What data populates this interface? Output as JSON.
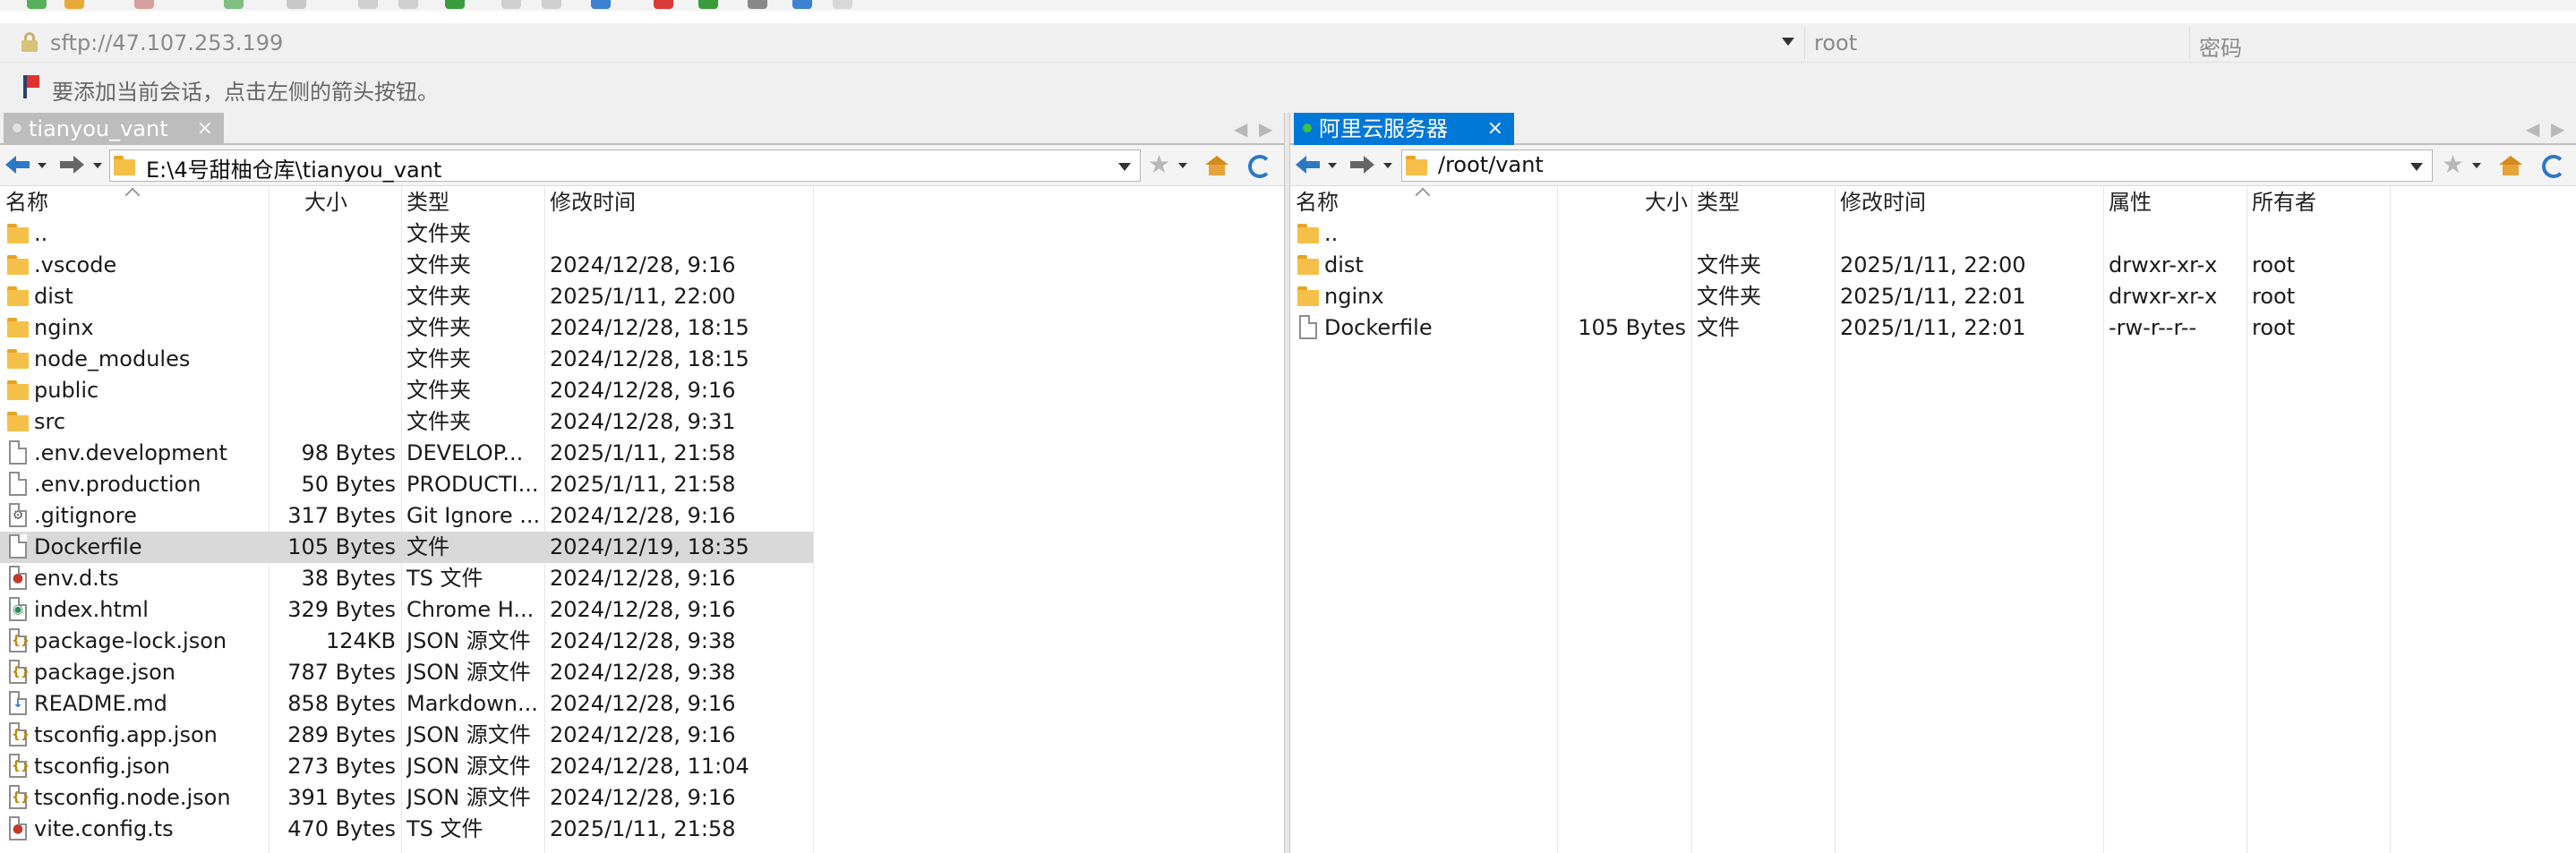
{
  "address": {
    "url": "sftp://47.107.253.199",
    "user_placeholder": "root",
    "password_placeholder": "密码"
  },
  "hint": {
    "text": "要添加当前会话，点击左侧的箭头按钮。"
  },
  "colors": {
    "accent": "#0078d7",
    "folder": "#f5c04a",
    "selected_row": "#d9d9d9",
    "tab_inactive": "#bdbdbd"
  },
  "left_pane": {
    "tab": {
      "label": "tianyou_vant",
      "close": "×",
      "dot_color": "#e0e0e0"
    },
    "path": "E:\\4号甜柚仓库\\tianyou_vant",
    "columns": {
      "name": "名称",
      "size": "大小",
      "type": "类型",
      "modified": "修改时间"
    },
    "files": [
      {
        "name": "..",
        "size": "",
        "type": "文件夹",
        "modified": "",
        "icon": "folder-icon",
        "glyph": "",
        "glyph_color": ""
      },
      {
        "name": ".vscode",
        "size": "",
        "type": "文件夹",
        "modified": "2024/12/28, 9:16",
        "icon": "folder-icon",
        "glyph": "",
        "glyph_color": ""
      },
      {
        "name": "dist",
        "size": "",
        "type": "文件夹",
        "modified": "2025/1/11, 22:00",
        "icon": "folder-icon",
        "glyph": "",
        "glyph_color": ""
      },
      {
        "name": "nginx",
        "size": "",
        "type": "文件夹",
        "modified": "2024/12/28, 18:15",
        "icon": "folder-icon",
        "glyph": "",
        "glyph_color": ""
      },
      {
        "name": "node_modules",
        "size": "",
        "type": "文件夹",
        "modified": "2024/12/28, 18:15",
        "icon": "folder-icon",
        "glyph": "",
        "glyph_color": ""
      },
      {
        "name": "public",
        "size": "",
        "type": "文件夹",
        "modified": "2024/12/28, 9:16",
        "icon": "folder-icon",
        "glyph": "",
        "glyph_color": ""
      },
      {
        "name": "src",
        "size": "",
        "type": "文件夹",
        "modified": "2024/12/28, 9:31",
        "icon": "folder-icon",
        "glyph": "",
        "glyph_color": ""
      },
      {
        "name": ".env.development",
        "size": "98 Bytes",
        "type": "DEVELOP...",
        "modified": "2025/1/11, 21:58",
        "icon": "file-icon",
        "glyph": "",
        "glyph_color": ""
      },
      {
        "name": ".env.production",
        "size": "50 Bytes",
        "type": "PRODUCTI...",
        "modified": "2025/1/11, 21:58",
        "icon": "file-icon",
        "glyph": "",
        "glyph_color": ""
      },
      {
        "name": ".gitignore",
        "size": "317 Bytes",
        "type": "Git Ignore ...",
        "modified": "2024/12/28, 9:16",
        "icon": "gitignore-file-icon",
        "glyph": "⚙",
        "glyph_color": "#555555"
      },
      {
        "name": "Dockerfile",
        "size": "105 Bytes",
        "type": "文件",
        "modified": "2024/12/19, 18:35",
        "icon": "file-icon",
        "glyph": "",
        "glyph_color": "",
        "selected": true
      },
      {
        "name": "env.d.ts",
        "size": "38 Bytes",
        "type": "TS 文件",
        "modified": "2024/12/28, 9:16",
        "icon": "ts-file-icon",
        "glyph": "●",
        "glyph_color": "#c0392b"
      },
      {
        "name": "index.html",
        "size": "329 Bytes",
        "type": "Chrome H...",
        "modified": "2024/12/28, 9:16",
        "icon": "chrome-html-file-icon",
        "glyph": "◉",
        "glyph_color": "#2e8b57"
      },
      {
        "name": "package-lock.json",
        "size": "124KB",
        "type": "JSON 源文件",
        "modified": "2024/12/28, 9:38",
        "icon": "json-file-icon",
        "glyph": "{}",
        "glyph_color": "#b8860b"
      },
      {
        "name": "package.json",
        "size": "787 Bytes",
        "type": "JSON 源文件",
        "modified": "2024/12/28, 9:38",
        "icon": "json-file-icon",
        "glyph": "{}",
        "glyph_color": "#b8860b"
      },
      {
        "name": "README.md",
        "size": "858 Bytes",
        "type": "Markdown...",
        "modified": "2024/12/28, 9:16",
        "icon": "markdown-file-icon",
        "glyph": "↓",
        "glyph_color": "#2b78c5"
      },
      {
        "name": "tsconfig.app.json",
        "size": "289 Bytes",
        "type": "JSON 源文件",
        "modified": "2024/12/28, 9:16",
        "icon": "json-file-icon",
        "glyph": "{}",
        "glyph_color": "#b8860b"
      },
      {
        "name": "tsconfig.json",
        "size": "273 Bytes",
        "type": "JSON 源文件",
        "modified": "2024/12/28, 11:04",
        "icon": "json-file-icon",
        "glyph": "{}",
        "glyph_color": "#b8860b"
      },
      {
        "name": "tsconfig.node.json",
        "size": "391 Bytes",
        "type": "JSON 源文件",
        "modified": "2024/12/28, 9:16",
        "icon": "json-file-icon",
        "glyph": "{}",
        "glyph_color": "#b8860b"
      },
      {
        "name": "vite.config.ts",
        "size": "470 Bytes",
        "type": "TS 文件",
        "modified": "2025/1/11, 21:58",
        "icon": "ts-file-icon",
        "glyph": "●",
        "glyph_color": "#c0392b"
      }
    ]
  },
  "right_pane": {
    "tab": {
      "label": "阿里云服务器",
      "close": "×",
      "dot_color": "#3cc23c"
    },
    "path": "/root/vant",
    "columns": {
      "name": "名称",
      "size": "大小",
      "type": "类型",
      "modified": "修改时间",
      "attrs": "属性",
      "owner": "所有者"
    },
    "files": [
      {
        "name": "..",
        "size": "",
        "type": "",
        "modified": "",
        "attrs": "",
        "owner": "",
        "icon": "folder-icon"
      },
      {
        "name": "dist",
        "size": "",
        "type": "文件夹",
        "modified": "2025/1/11, 22:00",
        "attrs": "drwxr-xr-x",
        "owner": "root",
        "icon": "folder-icon"
      },
      {
        "name": "nginx",
        "size": "",
        "type": "文件夹",
        "modified": "2025/1/11, 22:01",
        "attrs": "drwxr-xr-x",
        "owner": "root",
        "icon": "folder-icon"
      },
      {
        "name": "Dockerfile",
        "size": "105 Bytes",
        "type": "文件",
        "modified": "2025/1/11, 22:01",
        "attrs": "-rw-r--r--",
        "owner": "root",
        "icon": "file-icon"
      }
    ]
  }
}
